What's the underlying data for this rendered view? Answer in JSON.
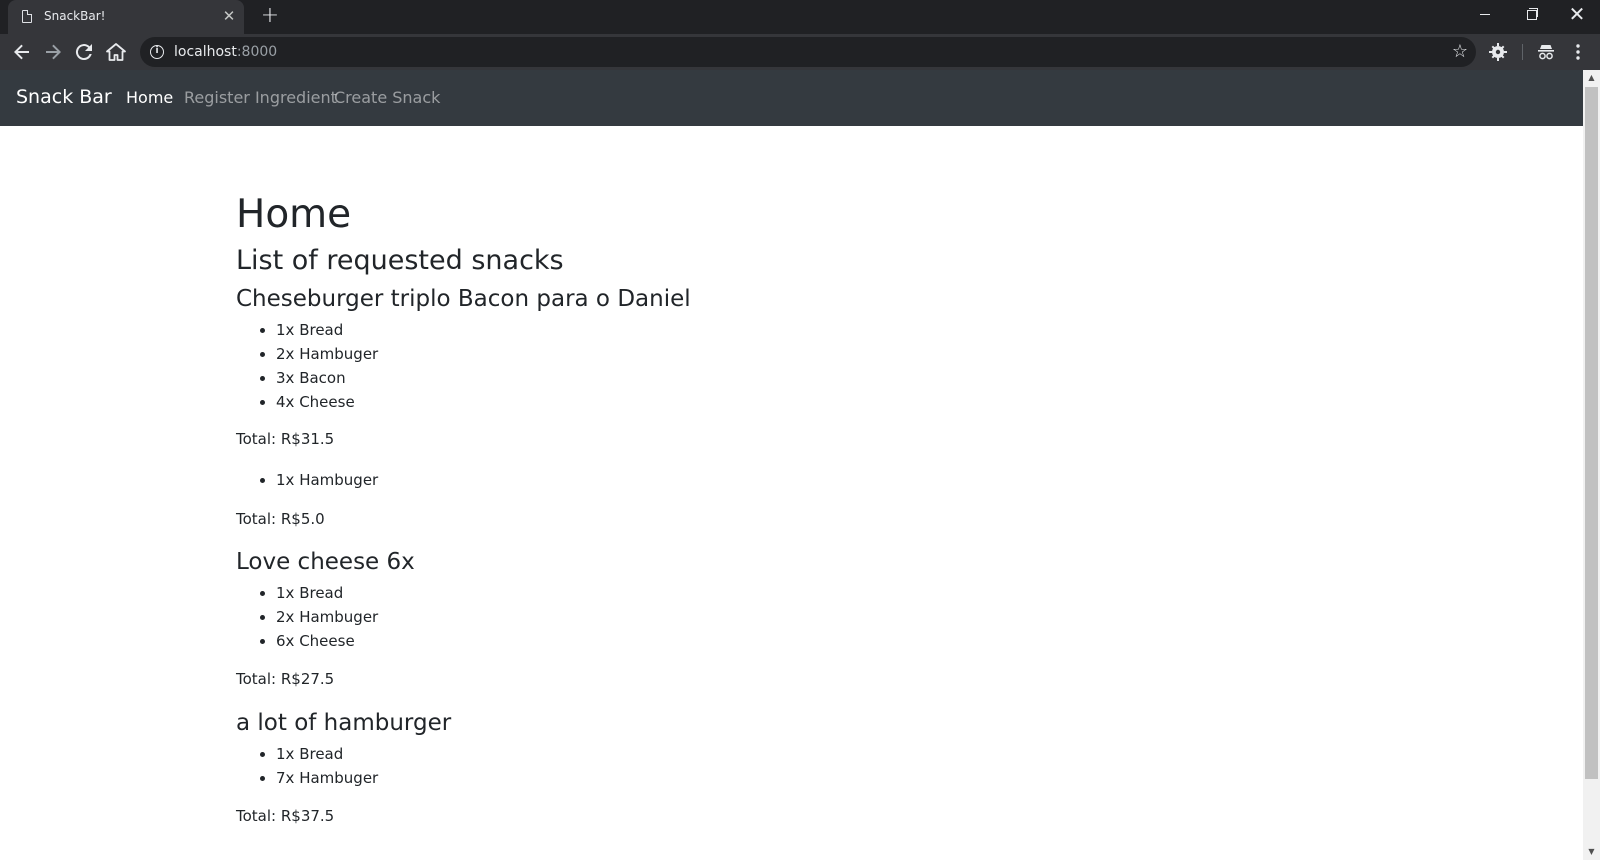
{
  "browser": {
    "tab_title": "SnackBar!",
    "url_host": "localhost",
    "url_port": ":8000"
  },
  "navbar": {
    "brand": "Snack Bar",
    "links": [
      {
        "label": "Home",
        "active": true
      },
      {
        "label": "Register Ingredient",
        "active": false
      },
      {
        "label": "Create Snack",
        "active": false
      }
    ]
  },
  "page": {
    "title": "Home",
    "subtitle": "List of requested snacks"
  },
  "snacks": [
    {
      "name": "Cheseburger triplo Bacon para o Daniel",
      "ingredients": [
        "1x Bread",
        "2x Hambuger",
        "3x Bacon",
        "4x Cheese"
      ],
      "total": "Total: R$31.5"
    },
    {
      "name": "",
      "ingredients": [
        "1x Hambuger"
      ],
      "total": "Total: R$5.0"
    },
    {
      "name": "Love cheese 6x",
      "ingredients": [
        "1x Bread",
        "2x Hambuger",
        "6x Cheese"
      ],
      "total": "Total: R$27.5"
    },
    {
      "name": "a lot of hamburger",
      "ingredients": [
        "1x Bread",
        "7x Hambuger"
      ],
      "total": "Total: R$37.5"
    }
  ]
}
